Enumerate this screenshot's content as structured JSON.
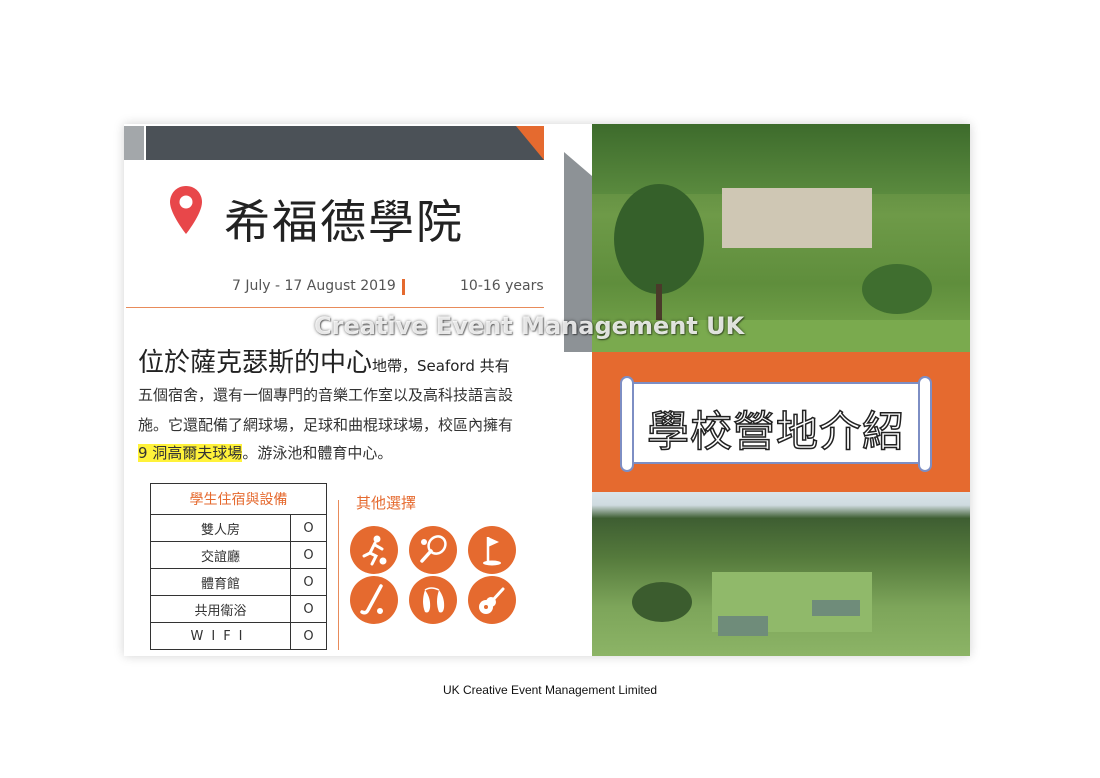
{
  "school": {
    "title": "希福德學院",
    "dates": "7 July - 17 August 2019",
    "ages": "10-16 years"
  },
  "description": {
    "lead": "位於薩克瑟斯的中心",
    "lead_rest": "地帶，Seaford 共有",
    "line2": "五個宿舍，還有一個專門的音樂工作室以及高科技語言設",
    "line3": "施。它還配備了網球場，足球和曲棍球球場，校區內擁有",
    "line4_highlight": "9 洞高爾夫球場",
    "line4_rest": "。游泳池和體育中心。"
  },
  "facilities": {
    "header": "學生住宿與設備",
    "rows": [
      {
        "name": "雙人房",
        "mark": "O"
      },
      {
        "name": "交誼廳",
        "mark": "O"
      },
      {
        "name": "體育館",
        "mark": "O"
      },
      {
        "name": "共用衛浴",
        "mark": "O"
      },
      {
        "name": "WIFI",
        "mark": "O"
      }
    ]
  },
  "other_options": {
    "title": "其他選擇",
    "icons": [
      "football-icon",
      "tennis-icon",
      "golf-icon",
      "hockey-icon",
      "ballet-icon",
      "guitar-icon"
    ]
  },
  "banner": {
    "text": "學校營地介紹"
  },
  "watermark": "Creative Event Management UK",
  "footer": "UK Creative Event Management Limited",
  "colors": {
    "accent": "#e56a2f",
    "dark_bar": "#4b5157",
    "scroll_border": "#7d8ec4"
  }
}
